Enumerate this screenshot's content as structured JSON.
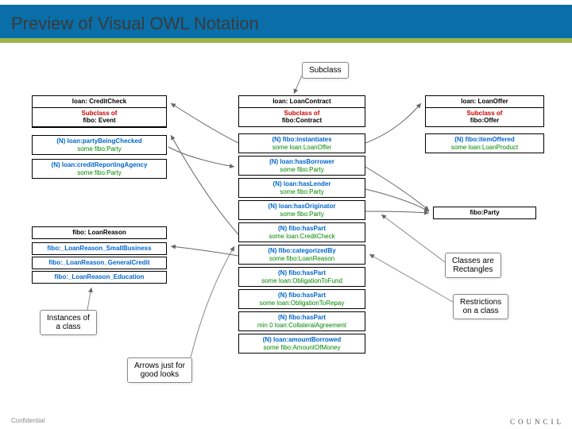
{
  "header": {
    "title": "Preview of Visual OWL Notation"
  },
  "notes": {
    "subclass": "Subclass",
    "classes": "Classes are\nRectangles",
    "restrictions": "Restrictions\non a class",
    "instances": "Instances of\na class",
    "arrows": "Arrows just for\ngood looks"
  },
  "creditCheck": {
    "title": "loan: CreditCheck",
    "sub": "Subclass of",
    "subv": "fibo: Event",
    "p1": "(N) loan:partyBeingChecked",
    "p1v": "some fibo:Party",
    "p2": "(N) loan:creditReportingAgency",
    "p2v": "some fibo:Party"
  },
  "loanReason": {
    "title": "fibo: LoanReason",
    "i1": "fibo:_LoanReason_SmallBusiness",
    "i2": "fibo:_LoanReason_GeneralCredit",
    "i3": "fibo:_LoanReason_Education"
  },
  "loanContract": {
    "title": "loan: LoanContract",
    "sub": "Subclass of",
    "subv": "fibo:Contract",
    "r1": "(N) fibo:instantiates",
    "r1v": "some loan:LoanOffer",
    "r2": "(N) loan:hasBorrower",
    "r2v": "some fibo:Party",
    "r3": "(N) loan:hasLender",
    "r3v": "some fibo:Party",
    "r4": "(N) loan:hasOriginator",
    "r4v": "some fibo:Party",
    "r5": "(N) fibo:hasPart",
    "r5v": "some loan:CreditCheck",
    "r6": "(N) fibo:categorizedBy",
    "r6v": "some fibo:LoanReason",
    "r7": "(N) fibo:hasPart",
    "r7v": "some loan:ObligationToFund",
    "r8": "(N) fibo:hasPart",
    "r8v": "some loan:ObligationToRepay",
    "r9": "(N) fibo:hasPart",
    "r9v": "min 0 loan:CollateralAgreement",
    "r10": "(N) loan:amountBorrowed",
    "r10v": "some fibo:AmountOfMoney"
  },
  "loanOffer": {
    "title": "loan: LoanOffer",
    "sub": "Subclass of",
    "subv": "fibo:Offer",
    "r1": "(N) fibo:itemOffered",
    "r1v": "some loan:LoanProduct"
  },
  "party": {
    "title": "fibo:Party"
  },
  "footer": "Confidential",
  "logo": "COUNCIL"
}
